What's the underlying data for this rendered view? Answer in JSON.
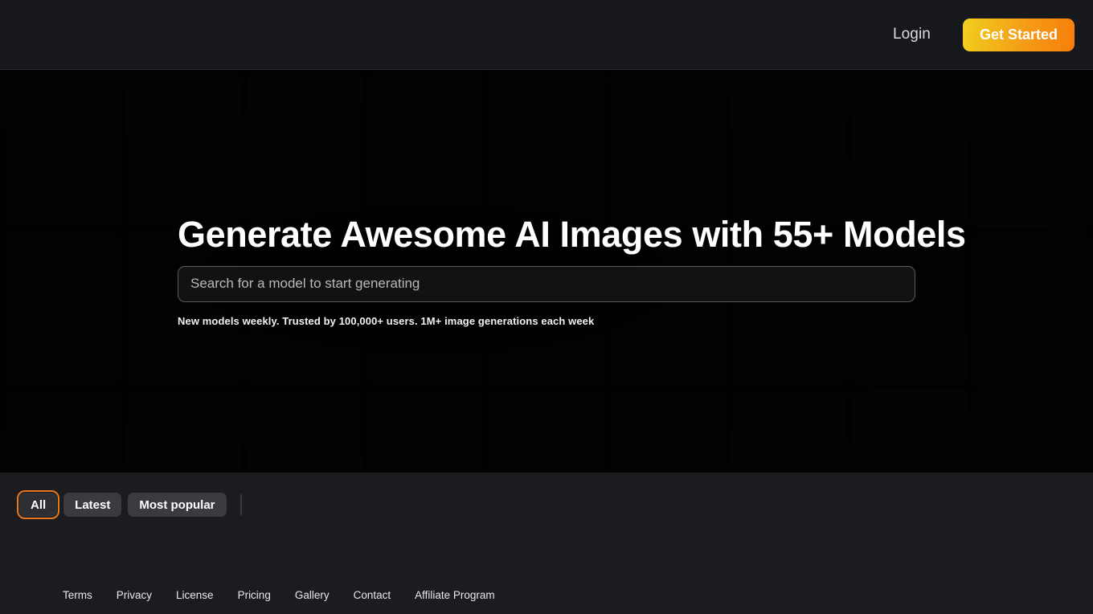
{
  "header": {
    "login_label": "Login",
    "cta_label": "Get Started",
    "cta_gradient_start": "#f5d020",
    "cta_gradient_end": "#f77d0a",
    "background": "#17181c"
  },
  "hero": {
    "title": "Generate Awesome AI Images with 55+ Models",
    "subtitle": "New models weekly. Trusted by 100,000+ users. 1M+ image generations each week",
    "background": "#050505",
    "search": {
      "placeholder": "Search for a model to start generating",
      "value": "",
      "border_color": "#5a5a5a"
    }
  },
  "filters": {
    "background": "#1b1c20",
    "active_outline_color": "#e8761a",
    "chips": [
      {
        "label": "All",
        "active": true
      },
      {
        "label": "Latest",
        "active": false
      },
      {
        "label": "Most popular",
        "active": false
      }
    ]
  },
  "footer": {
    "background": "#1b1c20",
    "links": [
      {
        "label": "Terms"
      },
      {
        "label": "Privacy"
      },
      {
        "label": "License"
      },
      {
        "label": "Pricing"
      },
      {
        "label": "Gallery"
      },
      {
        "label": "Contact"
      },
      {
        "label": "Affiliate Program"
      }
    ]
  }
}
